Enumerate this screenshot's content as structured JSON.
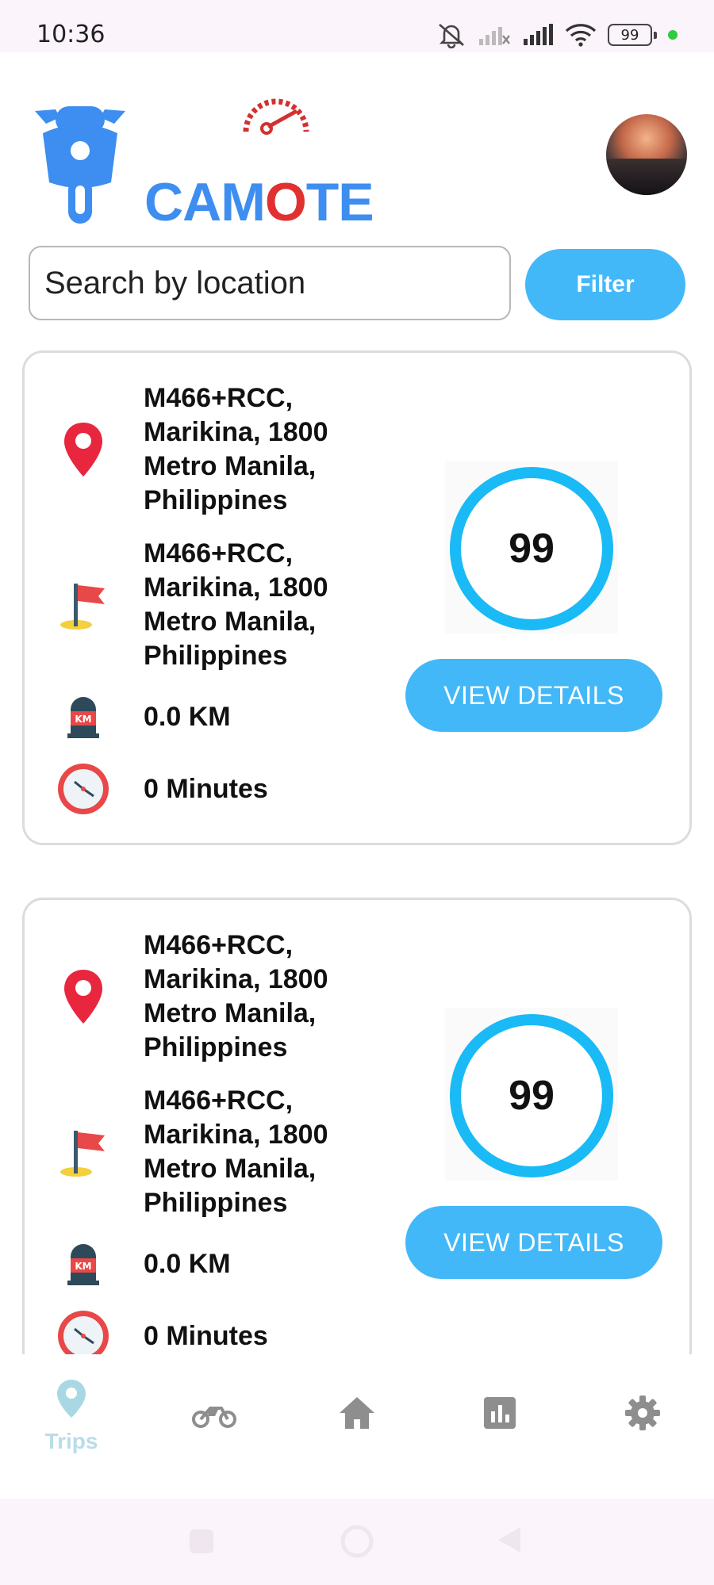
{
  "status_bar": {
    "time": "10:36",
    "battery": "99"
  },
  "header": {
    "logo_text": "CAMOTE",
    "logo_alt": "Camote logo"
  },
  "search": {
    "placeholder": "Search by location",
    "value": ""
  },
  "filter_label": "Filter",
  "trips": [
    {
      "start": "M466+RCC, Marikina, 1800 Metro Manila, Philippines",
      "end": "M466+RCC, Marikina, 1800 Metro Manila, Philippines",
      "distance": "0.0 KM",
      "duration": "0 Minutes",
      "score": "99",
      "button": "VIEW DETAILS"
    },
    {
      "start": "M466+RCC, Marikina, 1800 Metro Manila, Philippines",
      "end": "M466+RCC, Marikina, 1800 Metro Manila, Philippines",
      "distance": "0.0 KM",
      "duration": "0 Minutes",
      "score": "99",
      "button": "VIEW DETAILS"
    }
  ],
  "nav": {
    "trips_label": "Trips",
    "active": "trips"
  },
  "colors": {
    "accent": "#43b8f8",
    "ring": "#19baf6",
    "logo_blue": "#3d8ef0",
    "pin_red": "#e8263e",
    "nav_active": "#b9dcea",
    "nav_inactive": "#8e8e8e"
  },
  "icons": {
    "start": "location-pin-icon",
    "end": "flag-icon",
    "distance": "km-marker-icon",
    "duration": "clock-icon"
  }
}
